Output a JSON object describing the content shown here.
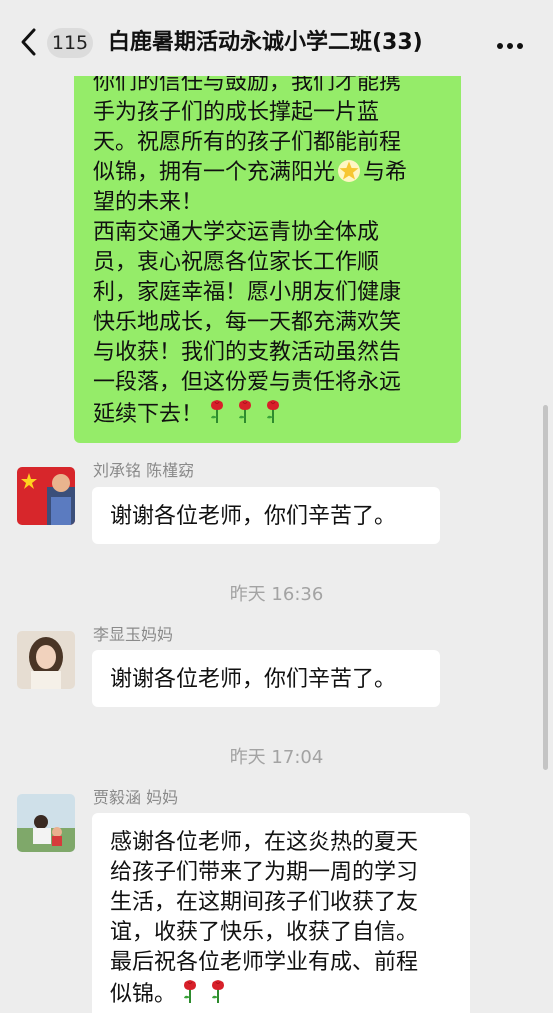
{
  "header": {
    "back_badge": "115",
    "title": "白鹿暑期活动永诚小学二班(33)"
  },
  "sent_message": {
    "lines": [
      "你们的信任与鼓励，我们才能携",
      "手为孩子们的成长撑起一片蓝",
      "天。祝愿所有的孩子们都能前程",
      "似锦，拥有一个充满阳光",
      "与希",
      "望的未来！",
      "西南交通大学交运青协全体成",
      "员，衷心祝愿各位家长工作顺",
      "利，家庭幸福！愿小朋友们健康",
      "快乐地成长，每一天都充满欢笑",
      "与收获！我们的支教活动虽然告",
      "一段落，但这份爱与责任将永远",
      "延续下去！"
    ]
  },
  "messages": [
    {
      "sender": "刘承铭 陈槿窈",
      "text": "谢谢各位老师，你们辛苦了。"
    },
    {
      "time": "昨天 16:36",
      "sender": "李显玉妈妈",
      "text": "谢谢各位老师，你们辛苦了。"
    },
    {
      "time": "昨天 17:04",
      "sender": "贾毅涵 妈妈",
      "lines": [
        "感谢各位老师，在这炎热的夏天",
        "给孩子们带来了为期一周的学习",
        "生活，在这期间孩子们收获了友",
        "谊，收获了快乐，收获了自信。",
        "最后祝各位老师学业有成、前程",
        "似锦。"
      ]
    }
  ],
  "icons": {
    "back": "chevron-left-icon",
    "more": "more-dots-icon",
    "rose": "rose-emoji-icon",
    "star": "star-emoji-icon"
  },
  "colors": {
    "background": "#ededed",
    "sent_bubble": "#95ec69",
    "received_bubble": "#ffffff"
  }
}
